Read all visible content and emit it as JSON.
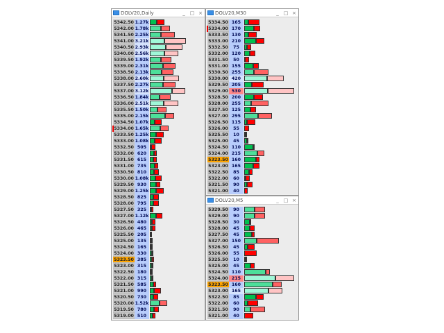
{
  "windows": [
    {
      "id": "daily",
      "title": "DOLV20,Daily",
      "controls": [
        "_",
        "□",
        "×"
      ],
      "current_price": "5323.50",
      "marker_price": "5334.00",
      "max_label": "",
      "rows": [
        [
          "5342.50",
          "1.27k",
          1270,
          0.5
        ],
        [
          "5342.00",
          "1.78k",
          1780,
          0.55
        ],
        [
          "5341.50",
          "2.25k",
          2250,
          0.45
        ],
        [
          "5341.00",
          "3.21k",
          3210,
          0.4
        ],
        [
          "5340.50",
          "2.93k",
          2930,
          0.49
        ],
        [
          "5340.00",
          "2.56k",
          2560,
          0.5
        ],
        [
          "5339.50",
          "1.92k",
          1920,
          0.5
        ],
        [
          "5339.00",
          "2.31k",
          2310,
          0.51
        ],
        [
          "5338.50",
          "2.13k",
          2130,
          0.48
        ],
        [
          "5338.00",
          "2.60k",
          2600,
          0.47
        ],
        [
          "5337.50",
          "2.27k",
          2270,
          0.51
        ],
        [
          "5337.00",
          "3.12k",
          3120,
          0.63
        ],
        [
          "5336.50",
          "1.84k",
          1840,
          0.47
        ],
        [
          "5336.00",
          "2.51k",
          2510,
          0.48
        ],
        [
          "5335.50",
          "1.50k",
          1500,
          0.45
        ],
        [
          "5335.00",
          "2.15k",
          2150,
          0.64
        ],
        [
          "5334.50",
          "1.07k",
          1070,
          0.4
        ],
        [
          "5334.00",
          "1.65k",
          1650,
          0.55
        ],
        [
          "5333.50",
          "1.25k",
          1250,
          0.45
        ],
        [
          "5333.00",
          "1.08k",
          1080,
          0.4
        ],
        [
          "5332.50",
          "505",
          505,
          0.3
        ],
        [
          "5332.00",
          "620",
          620,
          0.6
        ],
        [
          "5331.50",
          "615",
          615,
          0.55
        ],
        [
          "5331.00",
          "735",
          735,
          0.55
        ],
        [
          "5330.50",
          "810",
          810,
          0.45
        ],
        [
          "5330.00",
          "1.08k",
          1080,
          0.45
        ],
        [
          "5329.50",
          "930",
          930,
          0.6
        ],
        [
          "5329.00",
          "1.25k",
          1250,
          0.45
        ],
        [
          "5328.50",
          "825",
          825,
          0.4
        ],
        [
          "5328.00",
          "795",
          795,
          0.35
        ],
        [
          "5327.50",
          "325",
          325,
          0.4
        ],
        [
          "5327.00",
          "1.12k",
          1120,
          0.5
        ],
        [
          "5326.50",
          "480",
          480,
          0.35
        ],
        [
          "5326.00",
          "465",
          465,
          0.45
        ],
        [
          "5325.50",
          "205",
          205,
          0.45
        ],
        [
          "5325.00",
          "135",
          135,
          0.5
        ],
        [
          "5324.50",
          "165",
          165,
          0.6
        ],
        [
          "5324.00",
          "330",
          330,
          0.6
        ],
        [
          "5323.50",
          "385",
          385,
          0.55
        ],
        [
          "5323.00",
          "315",
          315,
          0.55
        ],
        [
          "5322.50",
          "180",
          180,
          0.5
        ],
        [
          "5322.00",
          "315",
          315,
          0.55
        ],
        [
          "5321.50",
          "585",
          585,
          0.55
        ],
        [
          "5321.00",
          "990",
          990,
          0.4
        ],
        [
          "5320.50",
          "730",
          730,
          0.45
        ],
        [
          "5320.00",
          "1.52k",
          1520,
          0.55
        ],
        [
          "5319.50",
          "780",
          780,
          0.45
        ],
        [
          "5319.00",
          "510",
          510,
          0.45
        ]
      ]
    },
    {
      "id": "m30",
      "title": "DOLV20,M30",
      "controls": [
        "_",
        "□",
        "×"
      ],
      "current_price": "5323.50",
      "marker_price": "5334.00",
      "max_label": "530",
      "rows": [
        [
          "5334.50",
          "165",
          165,
          0.25
        ],
        [
          "5334.00",
          "170",
          170,
          0.6
        ],
        [
          "5333.50",
          "130",
          130,
          0.35
        ],
        [
          "5333.00",
          "210",
          210,
          0.6
        ],
        [
          "5332.50",
          "75",
          75,
          0.4
        ],
        [
          "5332.00",
          "120",
          120,
          0.5
        ],
        [
          "5331.50",
          "50",
          50,
          0.15
        ],
        [
          "5331.00",
          "155",
          155,
          0.6
        ],
        [
          "5330.50",
          "255",
          255,
          0.4
        ],
        [
          "5330.00",
          "420",
          420,
          0.57
        ],
        [
          "5329.50",
          "205",
          205,
          0.4
        ],
        [
          "5329.00",
          "530",
          530,
          0.47
        ],
        [
          "5328.50",
          "200",
          200,
          0.5
        ],
        [
          "5328.00",
          "255",
          255,
          0.3
        ],
        [
          "5327.50",
          "125",
          125,
          0.55
        ],
        [
          "5327.00",
          "295",
          295,
          0.5
        ],
        [
          "5326.50",
          "115",
          115,
          0.25
        ],
        [
          "5326.00",
          "55",
          55,
          0
        ],
        [
          "5325.50",
          "10",
          10,
          0.5
        ],
        [
          "5325.00",
          "45",
          45,
          0.7
        ],
        [
          "5324.50",
          "110",
          110,
          0.9
        ],
        [
          "5324.00",
          "215",
          215,
          0.65
        ],
        [
          "5323.50",
          "160",
          160,
          0.8
        ],
        [
          "5323.00",
          "165",
          165,
          0.6
        ],
        [
          "5322.50",
          "85",
          85,
          0.6
        ],
        [
          "5322.00",
          "60",
          60,
          0.3
        ],
        [
          "5321.50",
          "90",
          90,
          0.35
        ],
        [
          "5321.00",
          "40",
          40,
          0
        ]
      ]
    },
    {
      "id": "m5",
      "title": "DOLV20,M5",
      "controls": [
        "_",
        "□",
        "×"
      ],
      "current_price": "5323.50",
      "marker_price": "",
      "max_label": "215",
      "rows": [
        [
          "5329.50",
          "90",
          90,
          0.5
        ],
        [
          "5329.00",
          "90",
          90,
          0.5
        ],
        [
          "5328.50",
          "30",
          30,
          0.8
        ],
        [
          "5328.00",
          "45",
          45,
          0.5
        ],
        [
          "5327.50",
          "45",
          45,
          0.75
        ],
        [
          "5327.00",
          "150",
          150,
          0.35
        ],
        [
          "5326.50",
          "45",
          45,
          0.3
        ],
        [
          "5326.00",
          "55",
          55,
          0
        ],
        [
          "5325.50",
          "10",
          10,
          0.5
        ],
        [
          "5325.00",
          "45",
          45,
          0.6
        ],
        [
          "5324.50",
          "110",
          110,
          0.85
        ],
        [
          "5324.00",
          "215",
          215,
          0.63
        ],
        [
          "5323.50",
          "160",
          160,
          0.76
        ],
        [
          "5323.00",
          "165",
          165,
          0.63
        ],
        [
          "5322.50",
          "85",
          85,
          0.6
        ],
        [
          "5322.00",
          "60",
          60,
          0.25
        ],
        [
          "5321.50",
          "90",
          90,
          0.3
        ],
        [
          "5321.00",
          "40",
          40,
          0
        ]
      ]
    }
  ],
  "colors": {
    "buy_strong": "#00c050",
    "buy_mid": "#4ddf9a",
    "buy_light": "#a0f7d8",
    "sell_strong": "#ff0000",
    "sell_mid": "#ff6262",
    "sell_light": "#ffc4c4",
    "current": "#ffa500"
  }
}
